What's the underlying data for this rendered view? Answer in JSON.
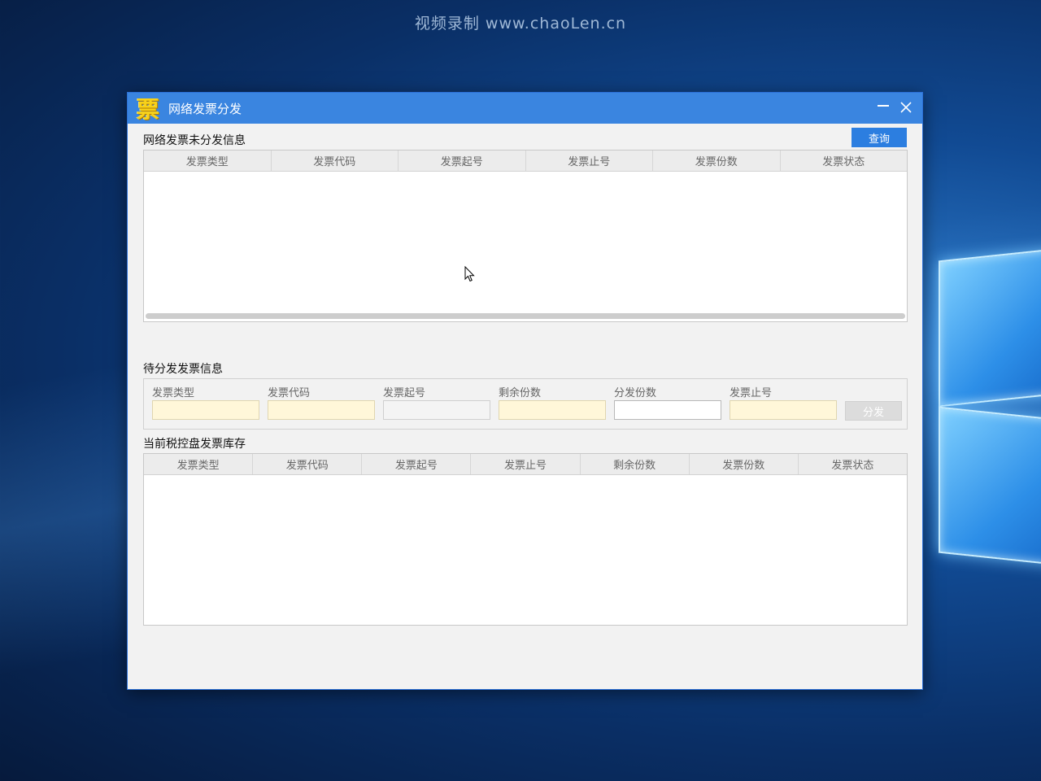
{
  "desktop": {
    "watermark": "视频录制 www.chaoLen.cn"
  },
  "window": {
    "icon_glyph": "票",
    "title": "网络发票分发",
    "minimize_icon": "minimize-icon",
    "close_icon": "close-icon"
  },
  "section1": {
    "title": "网络发票未分发信息",
    "query_label": "查询",
    "columns": [
      "发票类型",
      "发票代码",
      "发票起号",
      "发票止号",
      "发票份数",
      "发票状态"
    ],
    "rows": []
  },
  "section2": {
    "title": "待分发发票信息",
    "fields": [
      {
        "label": "发票类型",
        "value": ""
      },
      {
        "label": "发票代码",
        "value": ""
      },
      {
        "label": "发票起号",
        "value": ""
      },
      {
        "label": "剩余份数",
        "value": ""
      },
      {
        "label": "分发份数",
        "value": ""
      },
      {
        "label": "发票止号",
        "value": ""
      }
    ],
    "distribute_label": "分发"
  },
  "section3": {
    "title": "当前税控盘发票库存",
    "columns": [
      "发票类型",
      "发票代码",
      "发票起号",
      "发票止号",
      "剩余份数",
      "发票份数",
      "发票状态"
    ],
    "rows": []
  }
}
